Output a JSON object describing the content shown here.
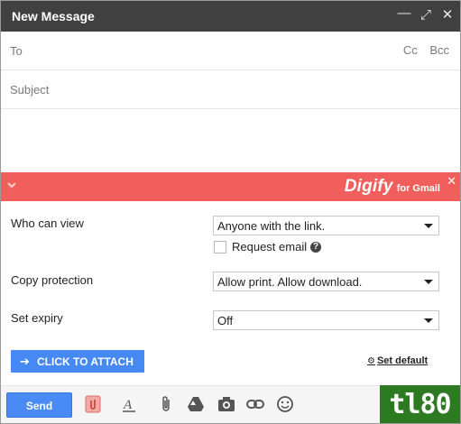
{
  "window": {
    "title": "New Message"
  },
  "fields": {
    "to_label": "To",
    "cc_label": "Cc",
    "bcc_label": "Bcc",
    "subject_placeholder": "Subject"
  },
  "digify": {
    "brand": "Digify",
    "brand_sub": "for Gmail",
    "brand_color": "#f05f5b",
    "who_can_view_label": "Who can view",
    "who_can_view_value": "Anyone with the link.",
    "request_email_label": "Request email",
    "request_email_checked": false,
    "copy_protection_label": "Copy protection",
    "copy_protection_value": "Allow print. Allow download.",
    "set_expiry_label": "Set expiry",
    "set_expiry_value": "Off",
    "attach_label": "CLICK TO ATTACH",
    "set_default_label": "Set default"
  },
  "toolbar": {
    "send_label": "Send",
    "icons": [
      "digify-icon",
      "formatting-icon",
      "attach-icon",
      "drive-icon",
      "photo-icon",
      "link-icon",
      "emoji-icon"
    ]
  },
  "watermark": {
    "text": "tl80"
  }
}
